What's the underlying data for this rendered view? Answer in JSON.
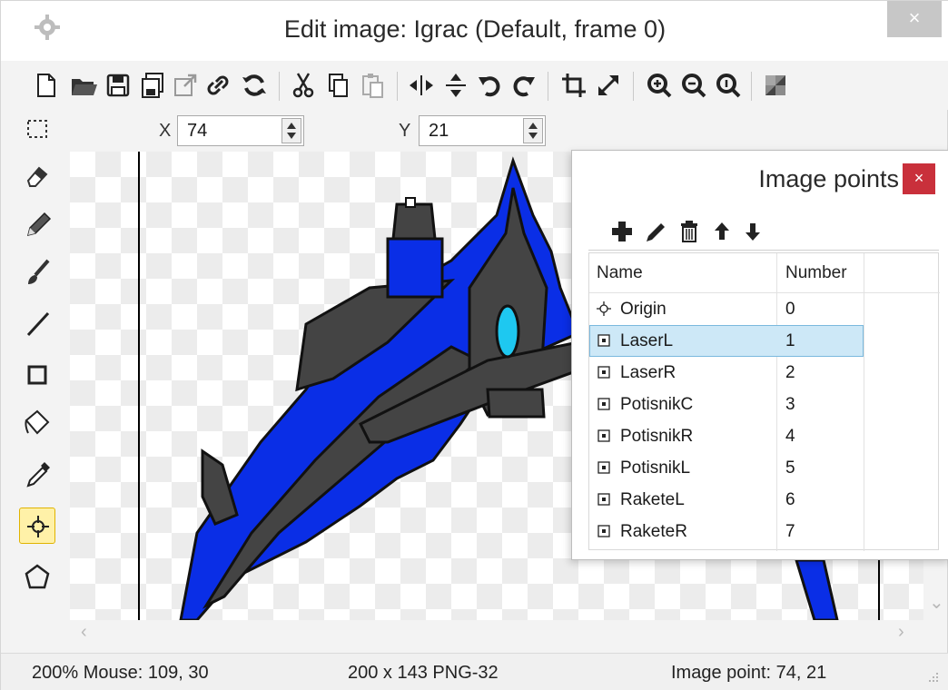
{
  "window": {
    "title": "Edit image: Igrac (Default, frame 0)",
    "close_label": "×"
  },
  "toolbar": {
    "buttons": [
      "new-icon",
      "open-icon",
      "save-icon",
      "save-as-icon",
      "export-icon",
      "link-icon",
      "reload-icon",
      "cut-icon",
      "copy-icon",
      "paste-icon",
      "flip-horizontal-icon",
      "flip-vertical-icon",
      "rotate-left-icon",
      "rotate-right-icon",
      "crop-icon",
      "resize-icon",
      "zoom-in-icon",
      "zoom-out-icon",
      "zoom-reset-icon",
      "transparency-icon"
    ]
  },
  "tools": [
    "select-icon",
    "eraser-icon",
    "pencil-icon",
    "brush-icon",
    "line-icon",
    "rectangle-icon",
    "fill-icon",
    "color-picker-icon",
    "origin-point-icon",
    "polygon-icon"
  ],
  "active_tool": "origin-point-icon",
  "coords": {
    "x_label": "X",
    "x_value": "74",
    "y_label": "Y",
    "y_value": "21"
  },
  "panel": {
    "title": "Image points",
    "close_label": "×",
    "toolbar": [
      "add-icon",
      "edit-icon",
      "delete-icon",
      "move-up-icon",
      "move-down-icon"
    ],
    "columns": {
      "name": "Name",
      "number": "Number"
    },
    "rows": [
      {
        "name": "Origin",
        "number": "0",
        "icon": "origin-icon"
      },
      {
        "name": "LaserL",
        "number": "1",
        "icon": "point-icon"
      },
      {
        "name": "LaserR",
        "number": "2",
        "icon": "point-icon"
      },
      {
        "name": "PotisnikC",
        "number": "3",
        "icon": "point-icon"
      },
      {
        "name": "PotisnikR",
        "number": "4",
        "icon": "point-icon"
      },
      {
        "name": "PotisnikL",
        "number": "5",
        "icon": "point-icon"
      },
      {
        "name": "RaketeL",
        "number": "6",
        "icon": "point-icon"
      },
      {
        "name": "RaketeR",
        "number": "7",
        "icon": "point-icon"
      }
    ],
    "selected_row": "LaserL"
  },
  "status": {
    "zoom_mouse": "200% Mouse: 109, 30",
    "image_info": "200 x 143  PNG-32",
    "image_point": "Image point: 74, 21"
  },
  "colors": {
    "ship_blue": "#0a2ee6",
    "ship_dark": "#444444",
    "cockpit": "#1ec8f0",
    "selection": "#cde8f7",
    "active_tool": "#fff1a8",
    "panel_close": "#c9303b"
  }
}
